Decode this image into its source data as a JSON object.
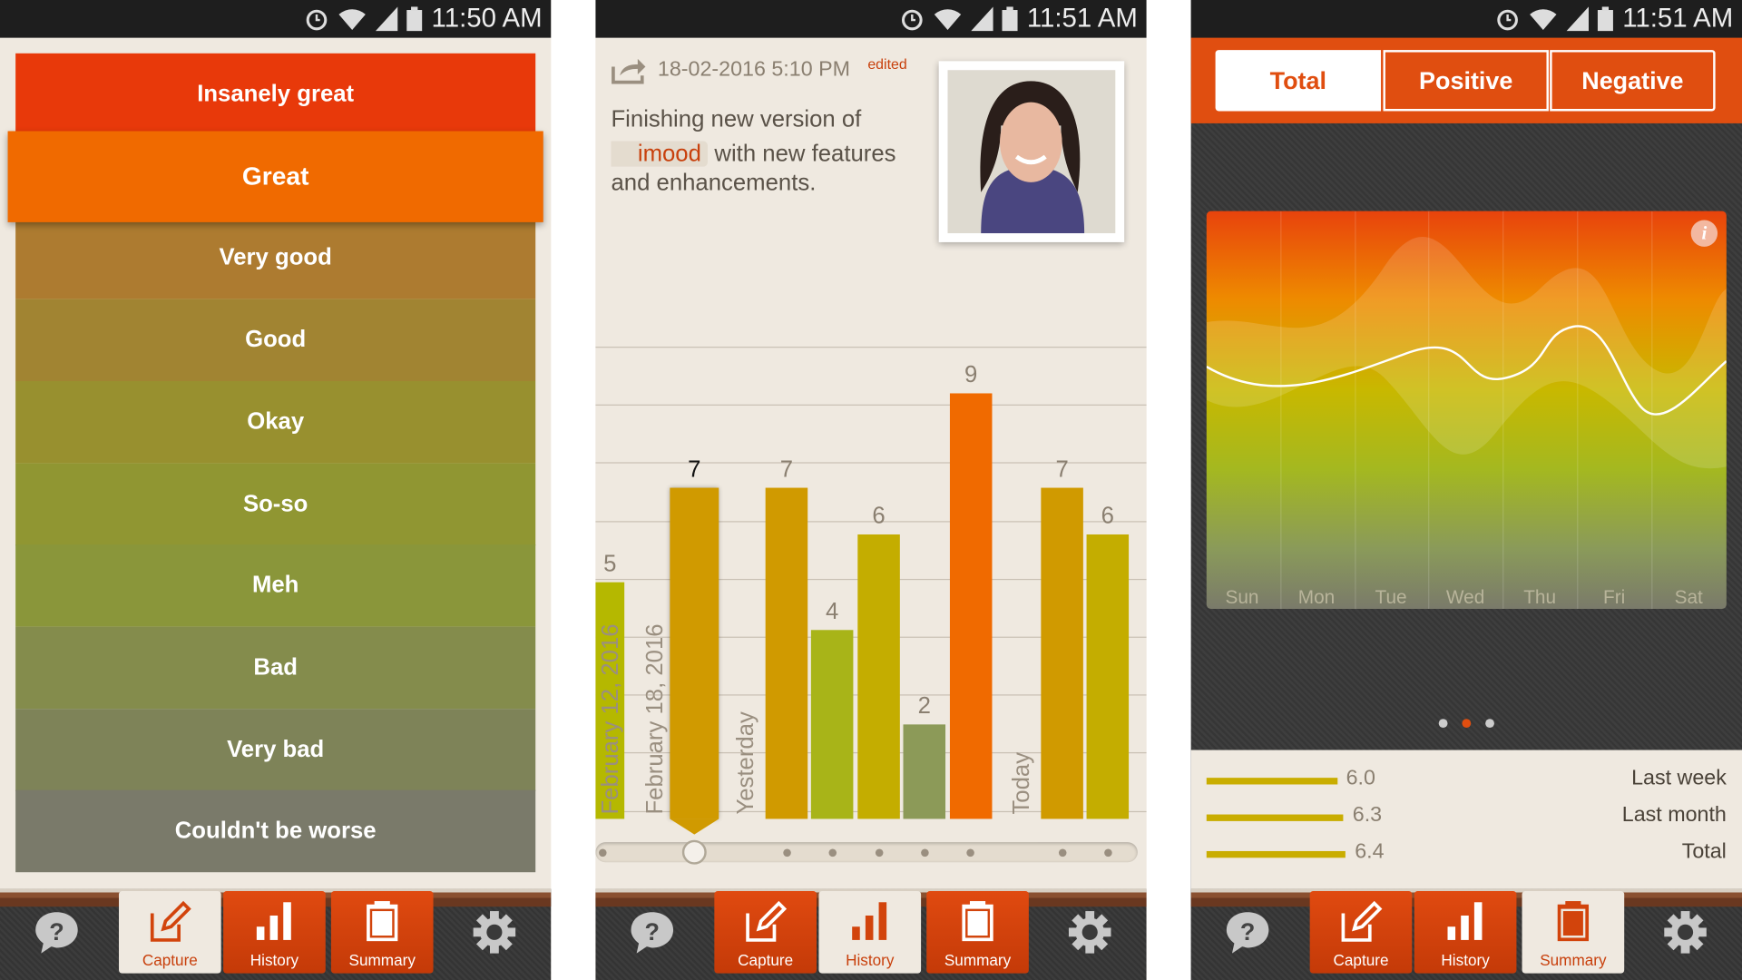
{
  "status_bars": [
    {
      "time": "11:50 AM"
    },
    {
      "time": "11:51 AM"
    },
    {
      "time": "11:51 AM"
    }
  ],
  "moods": [
    {
      "label": "Insanely great",
      "color": "#e8390a"
    },
    {
      "label": "Great",
      "color": "#f06a00",
      "selected": true
    },
    {
      "label": "Very good",
      "color": "#ad7b30"
    },
    {
      "label": "Good",
      "color": "#a18432"
    },
    {
      "label": "Okay",
      "color": "#98902f"
    },
    {
      "label": "So-so",
      "color": "#909632"
    },
    {
      "label": "Meh",
      "color": "#8a963a"
    },
    {
      "label": "Bad",
      "color": "#848c4c"
    },
    {
      "label": "Very bad",
      "color": "#7e8358"
    },
    {
      "label": "Couldn't be worse",
      "color": "#7a7a6a"
    }
  ],
  "nav": {
    "help_icon": "question-bubble-icon",
    "capture": "Capture",
    "history": "History",
    "summary": "Summary",
    "settings_icon": "gear-icon",
    "active": [
      "capture",
      "history",
      "summary"
    ]
  },
  "entry": {
    "date": "18-02-2016 5:10 PM",
    "edited": "edited",
    "text_before": "Finishing new version of",
    "tag": "imood",
    "text_after": "with new features",
    "text_line3": "and enhancements."
  },
  "chart_data": {
    "type": "bar",
    "categories": [
      "February 12, 2016",
      "",
      "February 18, 2016",
      "",
      "",
      "",
      "",
      "",
      "Yesterday",
      "",
      "",
      "",
      "Today",
      "",
      ""
    ],
    "date_labels": [
      "February 12, 2016",
      "February 18, 2016",
      "Yesterday",
      "Today"
    ],
    "values": [
      5,
      7,
      7,
      4,
      6,
      2,
      9,
      7,
      6
    ],
    "colors": [
      "#b5b800",
      "#d09a00",
      "#d09a00",
      "#a8b418",
      "#c4ad00",
      "#8c9a58",
      "#f06a00",
      "#d09a00",
      "#c4ad00"
    ],
    "selected_index": 1,
    "ylim": [
      0,
      10
    ]
  },
  "summary": {
    "tabs": [
      "Total",
      "Positive",
      "Negative"
    ],
    "active_tab": "Total",
    "days": [
      "Sun",
      "Mon",
      "Tue",
      "Wed",
      "Thu",
      "Fri",
      "Sat"
    ],
    "page_indicator": {
      "pages": 3,
      "current": 2
    },
    "info_icon": "info-icon",
    "stats": [
      {
        "value": "6.0",
        "label": "Last week",
        "level": 6.0
      },
      {
        "value": "6.3",
        "label": "Last month",
        "level": 6.3
      },
      {
        "value": "6.4",
        "label": "Total",
        "level": 6.4
      }
    ]
  },
  "colors": {
    "accent": "#e04e10",
    "paper": "#efe9e0",
    "dark": "#3a3a3a"
  }
}
